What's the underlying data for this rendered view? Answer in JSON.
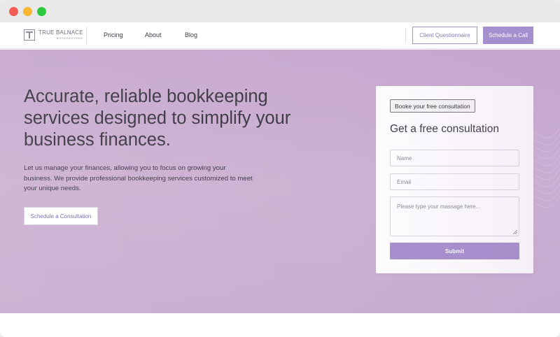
{
  "window": {
    "controls": [
      "close",
      "minimize",
      "maximize"
    ]
  },
  "nav": {
    "logo_name": "TRUE BALNACE",
    "logo_sub": "BOOKKEEPING",
    "links": [
      "Pricing",
      "About",
      "Blog"
    ],
    "client_questionnaire": "Client Questionnaire",
    "schedule_call": "Schedule a Call"
  },
  "hero": {
    "headline": "Accurate, reliable bookkeeping services designed to simplify your business finances.",
    "subtext": "Let us manage your finances, allowing you to focus on growing your business. We provide professional bookkeeping services customized to meet your unique needs.",
    "cta": "Schedule a Consultation"
  },
  "form": {
    "badge": "Booke your free consultation",
    "title": "Get a free consultation",
    "name_placeholder": "Name",
    "email_placeholder": "Email",
    "message_placeholder": "Please type your massage here...",
    "submit": "Submit"
  },
  "colors": {
    "accent": "#a58fcc",
    "hero_bg": "#c9aed1",
    "close": "#f25c54",
    "minimize": "#f7b731",
    "maximize": "#2bc840"
  }
}
